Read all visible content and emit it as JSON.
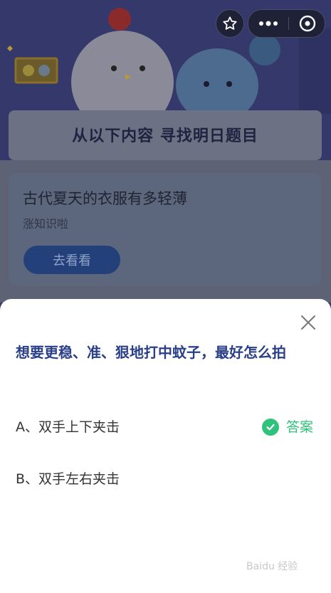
{
  "header": {
    "star_icon": "star-icon",
    "more_icon": "more-icon",
    "close_icon": "close-circle-icon"
  },
  "banner": {
    "title": "从以下内容  寻找明日题目"
  },
  "promo": {
    "title": "古代夏天的衣服有多轻薄",
    "subtitle": "涨知识啦",
    "button_label": "去看看"
  },
  "sheet": {
    "question": "想要更稳、准、狠地打中蚊子，最好怎么拍",
    "options": [
      {
        "label": "A、双手上下夹击",
        "answer_label": "答案"
      },
      {
        "label": "B、双手左右夹击"
      }
    ]
  },
  "watermark": "Baidu 经验",
  "colors": {
    "accent": "#2fc27a",
    "question": "#2a3f8a"
  }
}
